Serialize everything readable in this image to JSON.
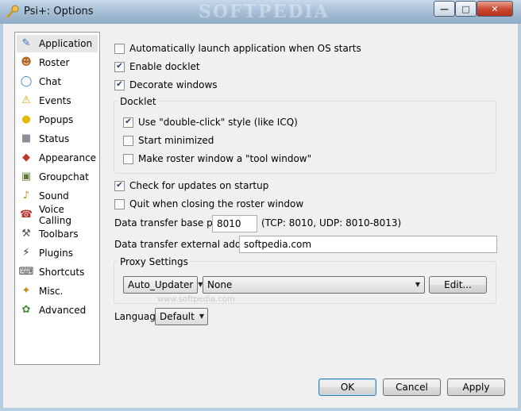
{
  "window": {
    "title": "Psi+: Options",
    "watermark": "SOFTPEDIA",
    "controls": {
      "minimize": "—",
      "maximize": "□",
      "close": "✕"
    }
  },
  "sidebar": {
    "items": [
      {
        "label": "Application",
        "icon": "application-icon",
        "glyph": "✎",
        "color": "#3a6fb5",
        "selected": true
      },
      {
        "label": "Roster",
        "icon": "roster-icon",
        "glyph": "☻",
        "color": "#b56a2a"
      },
      {
        "label": "Chat",
        "icon": "chat-icon",
        "glyph": "◯",
        "color": "#2a7fbf"
      },
      {
        "label": "Events",
        "icon": "events-icon",
        "glyph": "⚠",
        "color": "#d9a300"
      },
      {
        "label": "Popups",
        "icon": "popups-icon",
        "glyph": "●",
        "color": "#e6b800"
      },
      {
        "label": "Status",
        "icon": "status-icon",
        "glyph": "■",
        "color": "#8a8f99"
      },
      {
        "label": "Appearance",
        "icon": "appearance-icon",
        "glyph": "◆",
        "color": "#c0392b"
      },
      {
        "label": "Groupchat",
        "icon": "groupchat-icon",
        "glyph": "▣",
        "color": "#5e7d3a"
      },
      {
        "label": "Sound",
        "icon": "sound-icon",
        "glyph": "♪",
        "color": "#c08a1a"
      },
      {
        "label": "Voice Calling",
        "icon": "voice-calling-icon",
        "glyph": "☎",
        "color": "#b8342a"
      },
      {
        "label": "Toolbars",
        "icon": "toolbars-icon",
        "glyph": "⚒",
        "color": "#555"
      },
      {
        "label": "Plugins",
        "icon": "plugins-icon",
        "glyph": "⚡",
        "color": "#333"
      },
      {
        "label": "Shortcuts",
        "icon": "shortcuts-icon",
        "glyph": "⌨",
        "color": "#444"
      },
      {
        "label": "Misc.",
        "icon": "misc-icon",
        "glyph": "✦",
        "color": "#c78a1a"
      },
      {
        "label": "Advanced",
        "icon": "advanced-icon",
        "glyph": "✿",
        "color": "#4a8a3a"
      }
    ]
  },
  "options": {
    "auto_launch": {
      "label": "Automatically launch application when OS starts",
      "checked": false
    },
    "enable_docklet": {
      "label": "Enable docklet",
      "checked": true
    },
    "decorate_windows": {
      "label": "Decorate windows",
      "checked": true
    },
    "docklet": {
      "title": "Docklet",
      "double_click": {
        "label": "Use \"double-click\" style (like ICQ)",
        "checked": true
      },
      "start_minimized": {
        "label": "Start minimized",
        "checked": false
      },
      "tool_window": {
        "label": "Make roster window a \"tool window\"",
        "checked": false
      }
    },
    "check_updates": {
      "label": "Check for updates on startup",
      "checked": true
    },
    "quit_on_close": {
      "label": "Quit when closing the roster window",
      "checked": false
    },
    "transfer_port": {
      "label": "Data transfer base port:",
      "value": "8010",
      "hint": "(TCP: 8010, UDP: 8010-8013)"
    },
    "external_address": {
      "label": "Data transfer external address:",
      "value": "softpedia.com"
    },
    "proxy": {
      "title": "Proxy Settings",
      "service": "Auto_Updater",
      "proxy": "None",
      "edit_label": "Edit...",
      "watermark": "www.softpedia.com"
    },
    "language": {
      "label": "Language",
      "value": "Default"
    }
  },
  "footer": {
    "ok": "OK",
    "cancel": "Cancel",
    "apply": "Apply"
  },
  "check_glyph": "✔"
}
